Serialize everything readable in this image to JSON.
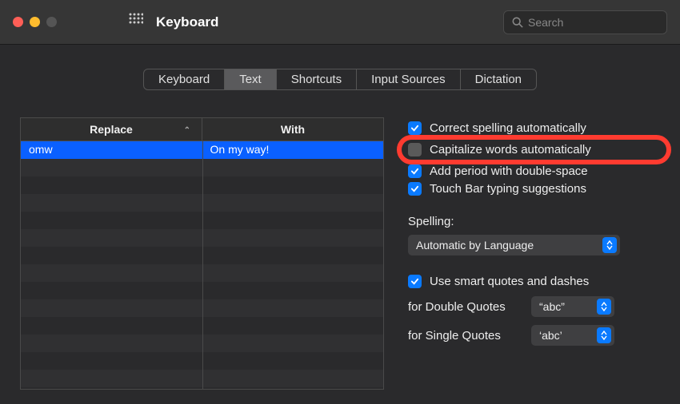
{
  "window": {
    "title": "Keyboard",
    "search_placeholder": "Search"
  },
  "tabs": [
    {
      "label": "Keyboard",
      "active": false
    },
    {
      "label": "Text",
      "active": true
    },
    {
      "label": "Shortcuts",
      "active": false
    },
    {
      "label": "Input Sources",
      "active": false
    },
    {
      "label": "Dictation",
      "active": false
    }
  ],
  "table": {
    "headers": {
      "replace": "Replace",
      "with": "With"
    },
    "rows": [
      {
        "replace": "omw",
        "with": "On my way!",
        "selected": true
      }
    ]
  },
  "checks": {
    "correct_spelling": {
      "label": "Correct spelling automatically",
      "checked": true
    },
    "capitalize": {
      "label": "Capitalize words automatically",
      "checked": false,
      "highlighted": true
    },
    "add_period": {
      "label": "Add period with double-space",
      "checked": true
    },
    "touch_bar": {
      "label": "Touch Bar typing suggestions",
      "checked": true
    },
    "smart_quotes": {
      "label": "Use smart quotes and dashes",
      "checked": true
    }
  },
  "spelling": {
    "label": "Spelling:",
    "value": "Automatic by Language"
  },
  "quotes": {
    "double_label": "for Double Quotes",
    "double_value": "“abc”",
    "single_label": "for Single Quotes",
    "single_value": "‘abc’"
  }
}
